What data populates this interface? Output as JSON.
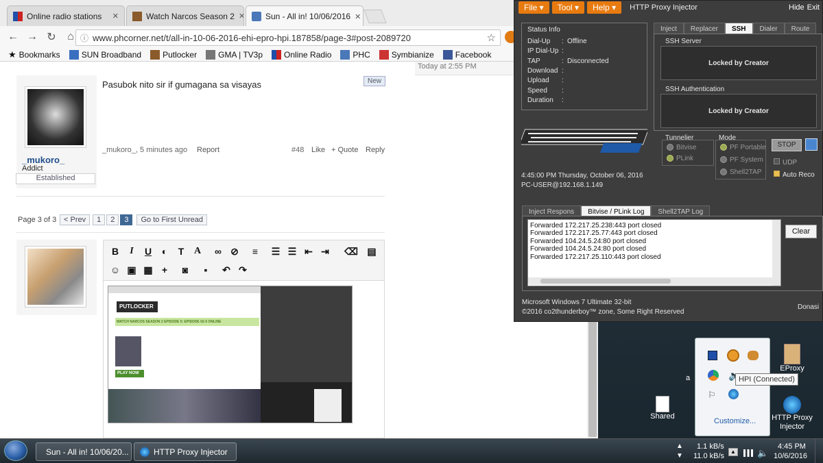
{
  "browser": {
    "tabs": [
      {
        "title": "Online radio stations"
      },
      {
        "title": "Watch Narcos Season 2"
      },
      {
        "title": "Sun - All in! 10/06/2016"
      }
    ],
    "url": "www.phcorner.net/t/all-in-10-06-2016-ehi-epro-hpi.187858/page-3#post-2089720",
    "bookmarks": [
      "Bookmarks",
      "SUN Broadband",
      "Putlocker",
      "GMA | TV3p",
      "Online Radio",
      "PHC",
      "Symbianize",
      "Facebook"
    ],
    "more": "»"
  },
  "page": {
    "top_time": "Today at 2:55 PM",
    "post": {
      "text": "Pasubok nito sir if gumagana sa visayas",
      "badge": "New",
      "username": "_mukoro_",
      "role": "Addict",
      "rank": "Established",
      "byline": "_mukoro_, 5 minutes ago",
      "report": "Report",
      "number": "#48",
      "like": "Like",
      "quote": "+ Quote",
      "reply": "Reply"
    },
    "pagination": {
      "label": "Page 3 of 3",
      "prev": "< Prev",
      "pages": [
        "1",
        "2",
        "3"
      ],
      "first_unread": "Go to First Unread"
    },
    "thumb_header": "WATCH NARCOS SEASON 2 EPISODE 5: EPISODE 02-5 ONLINE",
    "thumb_play": "PLAY NOW",
    "thumb_logo": "PUTLOCKER"
  },
  "hpi": {
    "title": "HTTP Proxy Injector",
    "menu": [
      "File",
      "Tool",
      "Help"
    ],
    "hide": "Hide",
    "exit": "Exit",
    "status": {
      "heading": "Status Info",
      "rows": [
        {
          "k": "Dial-Up",
          "v": "Offline"
        },
        {
          "k": "IP Dial-Up",
          "v": ""
        },
        {
          "k": "TAP",
          "v": "Disconnected"
        },
        {
          "k": "Download",
          "v": ""
        },
        {
          "k": "Upload",
          "v": ""
        },
        {
          "k": "Speed",
          "v": ""
        },
        {
          "k": "Duration",
          "v": ""
        }
      ]
    },
    "tabs": [
      "Inject",
      "Replacer",
      "SSH",
      "Dialer",
      "Route"
    ],
    "ssh_server": "SSH Server",
    "ssh_auth": "SSH Authentication",
    "locked": "Locked by Creator",
    "tunnelier": {
      "heading": "Tunnelier",
      "options": [
        "Bitvise",
        "PLink"
      ]
    },
    "mode": {
      "heading": "Mode",
      "options": [
        "PF Portable",
        "PF System",
        "Shell2TAP"
      ]
    },
    "stop": "STOP",
    "udp": "UDP",
    "autoreco": "Auto Reco",
    "datetime": "4:45:00 PM     Thursday, October 06, 2016",
    "user": "PC-USER@192.168.1.149",
    "log_tabs": [
      "Inject Respons",
      "Bitvise / PLink Log",
      "Shell2TAP Log"
    ],
    "log": [
      "Forwarded 172.217.25.238:443 port closed",
      "Forwarded 172.217.25.77:443 port closed",
      "Forwarded 104.24.5.24:80 port closed",
      "Forwarded 104.24.5.24:80 port closed",
      "Forwarded 172.217.25.110:443 port closed"
    ],
    "clear": "Clear",
    "os": "Microsoft Windows 7 Ultimate  32-bit",
    "copyright": "©2016  co2thunderboy™ zone, Some Right Reserved",
    "donate": "Donasi"
  },
  "desktop": {
    "icons": [
      "EProxy",
      "Shared",
      "HTTP Proxy Injector"
    ],
    "partial_text": "a",
    "tooltip": "HPI (Connected)",
    "customize": "Customize..."
  },
  "taskbar": {
    "buttons": [
      "Sun - All in! 10/06/20...",
      "HTTP Proxy Injector"
    ],
    "net_up": "1.1 kB/s",
    "net_down": "11.0 kB/s",
    "time": "4:45 PM",
    "date": "10/6/2016"
  }
}
